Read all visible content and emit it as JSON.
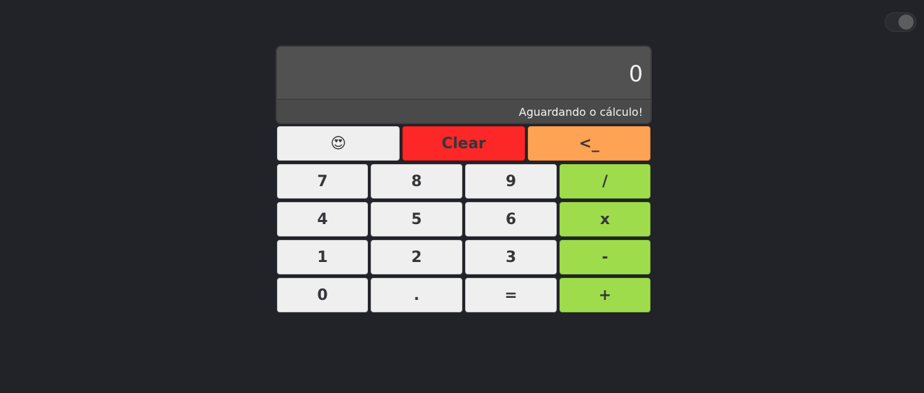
{
  "theme_toggle": {
    "state": "dark"
  },
  "display": {
    "value": "0",
    "status": "Aguardando o cálculo!"
  },
  "top_row": {
    "emoji": "😍",
    "clear": "Clear",
    "backspace": "<_"
  },
  "keypad": {
    "r1": [
      "7",
      "8",
      "9",
      "/"
    ],
    "r2": [
      "4",
      "5",
      "6",
      "x"
    ],
    "r3": [
      "1",
      "2",
      "3",
      "-"
    ],
    "r4": [
      "0",
      ".",
      "=",
      "+"
    ]
  },
  "colors": {
    "background": "#212329",
    "clear": "#fe2727",
    "backspace": "#fea253",
    "operator": "#9fdc4c",
    "key": "#efefef"
  }
}
